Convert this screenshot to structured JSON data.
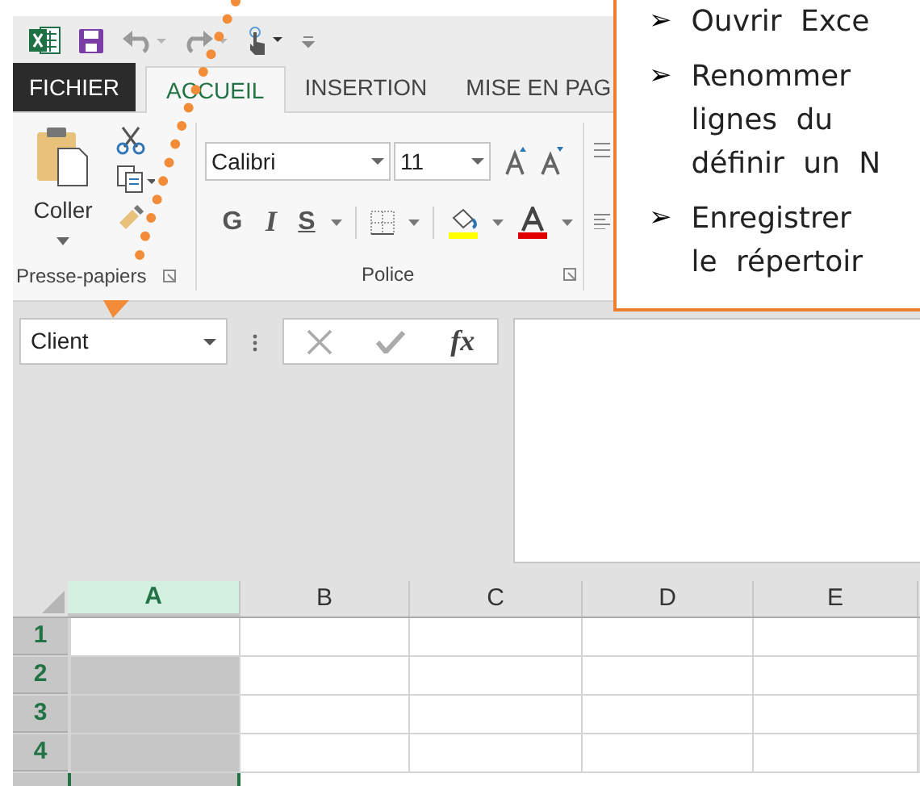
{
  "tabs": [
    {
      "label": "FICHIER",
      "kind": "file",
      "selected": false
    },
    {
      "label": "ACCUEIL",
      "kind": "tab",
      "selected": true
    },
    {
      "label": "INSERTION",
      "kind": "tab",
      "selected": false
    },
    {
      "label": "MISE EN PAG",
      "kind": "tab",
      "selected": false
    }
  ],
  "ribbon": {
    "clipboard": {
      "paste_label": "Coller",
      "group_label": "Presse-papiers"
    },
    "font": {
      "font_name": "Calibri",
      "font_size": "11",
      "bold": "G",
      "italic": "I",
      "underline": "S",
      "group_label": "Police"
    }
  },
  "name_box": {
    "value": "Client"
  },
  "formula_bar": {
    "fx": "fx"
  },
  "columns": [
    {
      "label": "A",
      "selected": true
    },
    {
      "label": "B",
      "selected": false
    },
    {
      "label": "C",
      "selected": false
    },
    {
      "label": "D",
      "selected": false
    },
    {
      "label": "E",
      "selected": false
    }
  ],
  "rows": [
    {
      "label": "1",
      "selected": true,
      "active_cell": true
    },
    {
      "label": "2",
      "selected": true,
      "active_cell": false
    },
    {
      "label": "3",
      "selected": true,
      "active_cell": false
    },
    {
      "label": "4",
      "selected": true,
      "active_cell": false
    }
  ],
  "callout": {
    "bullet": "➢",
    "items": [
      {
        "lines": [
          "Ouvrir Exce"
        ]
      },
      {
        "lines": [
          "Renommer",
          "lignes du",
          "définir un N"
        ]
      },
      {
        "lines": [
          "Enregistrer",
          "le répertoir"
        ]
      }
    ]
  }
}
